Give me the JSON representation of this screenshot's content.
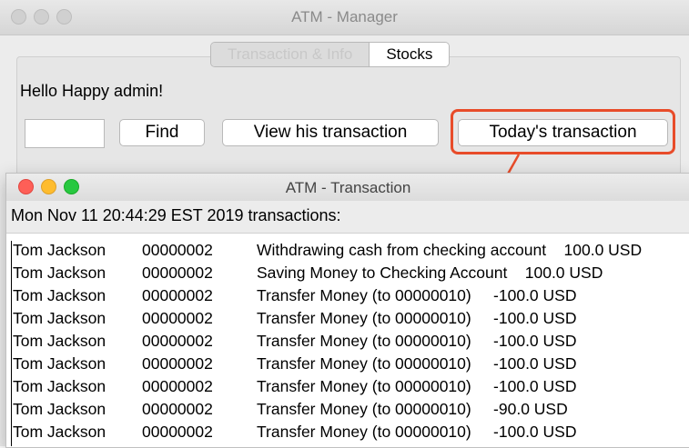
{
  "manager": {
    "title": "ATM - Manager",
    "tabs": [
      {
        "label": "Transaction & Info",
        "active": false
      },
      {
        "label": "Stocks",
        "active": true
      }
    ],
    "greeting": "Hello Happy admin!",
    "search_input": {
      "value": "",
      "placeholder": ""
    },
    "find_button": "Find",
    "view_button": "View his transaction",
    "today_button": "Today's transaction",
    "highlight_color": "#e84c2a"
  },
  "transaction_window": {
    "title": "ATM - Transaction",
    "heading": "Mon Nov 11 20:44:29 EST 2019 transactions:",
    "rows": [
      {
        "name": "Tom Jackson",
        "account": "00000002",
        "description": "Withdrawing cash from checking account    100.0 USD"
      },
      {
        "name": "Tom Jackson",
        "account": "00000002",
        "description": "Saving Money to Checking Account    100.0 USD"
      },
      {
        "name": "Tom Jackson",
        "account": "00000002",
        "description": "Transfer Money (to 00000010)     -100.0 USD"
      },
      {
        "name": "Tom Jackson",
        "account": "00000002",
        "description": "Transfer Money (to 00000010)     -100.0 USD"
      },
      {
        "name": "Tom Jackson",
        "account": "00000002",
        "description": "Transfer Money (to 00000010)     -100.0 USD"
      },
      {
        "name": "Tom Jackson",
        "account": "00000002",
        "description": "Transfer Money (to 00000010)     -100.0 USD"
      },
      {
        "name": "Tom Jackson",
        "account": "00000002",
        "description": "Transfer Money (to 00000010)     -100.0 USD"
      },
      {
        "name": "Tom Jackson",
        "account": "00000002",
        "description": "Transfer Money (to 00000010)     -90.0 USD"
      },
      {
        "name": "Tom Jackson",
        "account": "00000002",
        "description": "Transfer Money (to 00000010)     -100.0 USD"
      }
    ]
  }
}
